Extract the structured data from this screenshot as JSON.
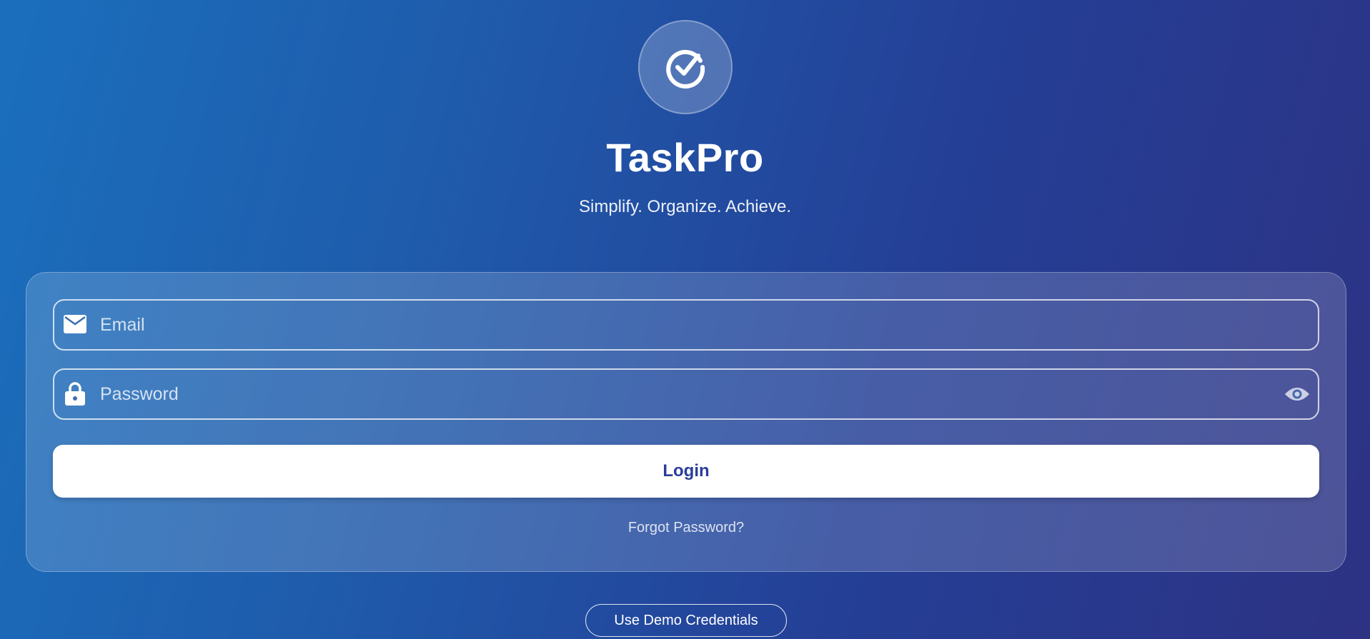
{
  "app": {
    "title": "TaskPro",
    "tagline": "Simplify. Organize. Achieve.",
    "logo_icon": "check-circle-icon"
  },
  "form": {
    "email": {
      "placeholder": "Email",
      "value": "",
      "icon": "mail-icon"
    },
    "password": {
      "placeholder": "Password",
      "value": "",
      "icon": "lock-icon",
      "toggle_icon": "eye-icon"
    },
    "login_label": "Login",
    "forgot_label": "Forgot Password?"
  },
  "demo_label": "Use Demo Credentials",
  "colors": {
    "background_start": "#1a6fbd",
    "background_end": "#2d3283",
    "login_text": "#2a3d99",
    "white": "#ffffff"
  }
}
